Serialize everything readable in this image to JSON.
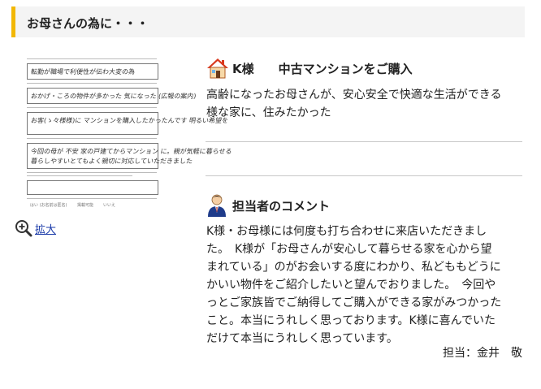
{
  "header": {
    "title": "お母さんの為に・・・"
  },
  "questionnaire": {
    "handwriting": [
      "転勤が職場で利便性が伝わ大変の為",
      "おかげ・ころの物件が多かった 気になった (広報の案内)",
      "お客(ゝ々様様)に マンションを購入したかったんです 明るい希望を",
      "今回の母が 不安 家の戸建てからマンション に。親が気軽に暮らせる",
      "暮らしやすいとてもよく親切に対応していただきました"
    ],
    "checkbox_labels": [
      "はい (お名前は匿名)",
      "掲載可能",
      "いいえ"
    ]
  },
  "zoom": {
    "label": "拡大"
  },
  "purchase": {
    "title": "K様　　中古マンションをご購入",
    "lines": [
      "高齢になったお母さんが、安心安全で快適な生活ができる",
      "様な家に、住みたかった"
    ]
  },
  "comment": {
    "title": "担当者のコメント",
    "lines": [
      "K様・お母様には何度も打ち合わせに来店いただきまし",
      "た。　K様が「お母さんが安心して暮らせる家を心から望",
      "まれている」のがお会いする度にわかり、私どももどうに",
      "かいい物件をご紹介したいと望んでおりました。　今回や",
      "っとご家族皆でご納得してご購入ができる家がみつかった",
      "こと。本当にうれしく思っております。K様に喜んでいた",
      "だけて本当にうれしく思っています。"
    ],
    "staff": "担当：金井　敬"
  },
  "colors": {
    "accent": "#f2b705",
    "link": "#1a3aa8",
    "house_roof": "#d9391e",
    "staff_suit": "#1f3b8a"
  }
}
